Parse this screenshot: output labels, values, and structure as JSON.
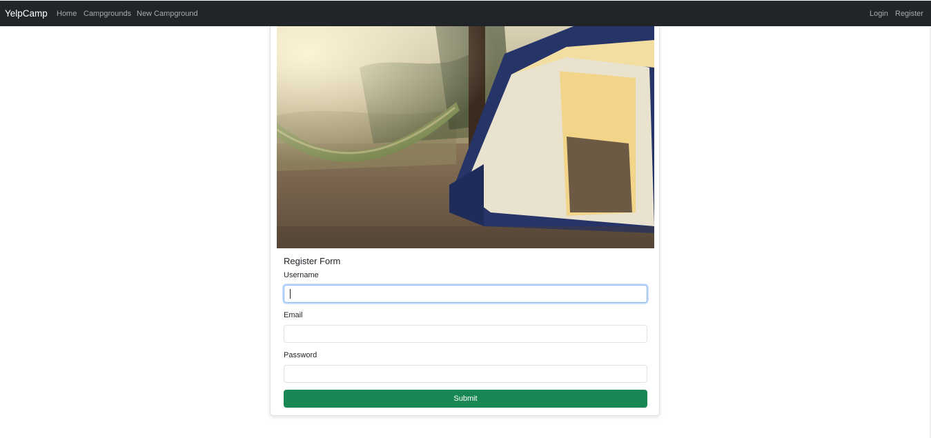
{
  "navbar": {
    "brand": "YelpCamp",
    "links": [
      "Home",
      "Campgrounds",
      "New Campground"
    ],
    "right_links": [
      "Login",
      "Register"
    ],
    "background": "#212529"
  },
  "hero": {
    "icon": "campsite-photo-tent-hammock"
  },
  "form": {
    "title": "Register Form",
    "username_label": "Username",
    "username_value": "",
    "email_label": "Email",
    "email_value": "",
    "password_label": "Password",
    "password_value": "",
    "submit_label": "Submit",
    "submit_color": "#198754"
  }
}
